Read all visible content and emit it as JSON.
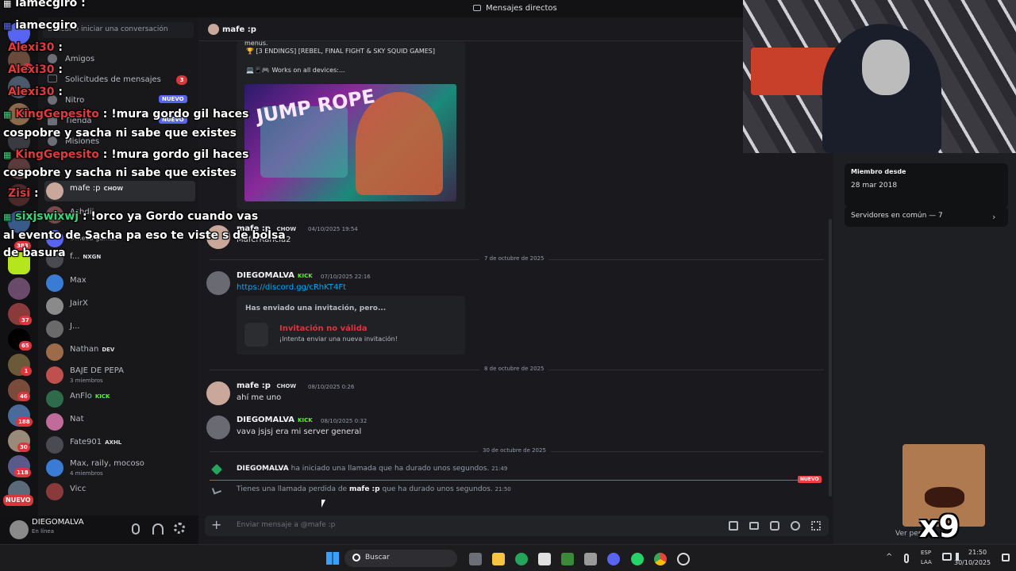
{
  "window": {
    "title": "Mensajes directos"
  },
  "sidebar": {
    "search_placeholder": "Buscar o iniciar una conversación",
    "nav": [
      {
        "label": "Amigos"
      },
      {
        "label": "Solicitudes de mensajes",
        "badge": "3"
      },
      {
        "label": "Nitro",
        "badge": "NUEVO"
      },
      {
        "label": "Tienda",
        "badge": "NUEVO"
      },
      {
        "label": "Misiones"
      }
    ],
    "dms": [
      {
        "name": "mafe :p",
        "tag": "CHOW",
        "color": "#c9a79a"
      },
      {
        "name": "Ashdii",
        "tag": "",
        "color": "#7a4a4a"
      },
      {
        "name": "#meeb-games",
        "tag": "",
        "color": "#5865f2"
      },
      {
        "name": "f...",
        "tag": "NXGN",
        "color": "#4a4a52"
      },
      {
        "name": "Max",
        "tag": "",
        "color": "#3a7bd5"
      },
      {
        "name": "JairX",
        "tag": "",
        "color": "#8a8a8a"
      },
      {
        "name": "J...",
        "tag": "",
        "color": "#6a6a6a"
      },
      {
        "name": "Nathan",
        "tag": "DEV",
        "color": "#9c6b4a"
      },
      {
        "name": "BAJE DE PEPA",
        "sub": "3 miembros",
        "color": "#c0504d"
      },
      {
        "name": "AnFlo",
        "tag": "KICK",
        "color": "#2e6b4a"
      },
      {
        "name": "Nat",
        "tag": "",
        "color": "#c06b9a"
      },
      {
        "name": "Fate901",
        "tag": "AXHL",
        "color": "#4a4a52"
      },
      {
        "name": "Max, raily, mocoso",
        "sub": "4 miembros",
        "color": "#3a7bd5"
      },
      {
        "name": "Vicc",
        "tag": "",
        "color": "#8a3a3a"
      }
    ]
  },
  "server_rail": {
    "badges": [
      "3",
      "383",
      "37",
      "65",
      "1",
      "46",
      "188",
      "30",
      "118"
    ],
    "new_label": "NUEVO"
  },
  "user_panel": {
    "name": "DIEGOMALVA",
    "status": "En línea"
  },
  "chat": {
    "recipient": "mafe :p",
    "embed_line1": "menus.",
    "embed_line2": "[3 ENDINGS] [REBEL, FINAL FIGHT & SKY SQUID GAMES]",
    "embed_line3": "Works on all devices:...",
    "embed_image_text": "JUMP ROPE",
    "messages": [
      {
        "author": "mafe :p",
        "tag": "CHOW",
        "time": "04/10/2025 19:54",
        "text": "MaferRancia2"
      },
      {
        "author": "DIEGOMALVA",
        "tag": "KICK",
        "time": "07/10/2025 22:16",
        "link": "https://discord.gg/cRhKT4Ft"
      },
      {
        "author": "mafe :p",
        "tag": "CHOW",
        "time": "08/10/2025 0:26",
        "text": "ahí me uno"
      },
      {
        "author": "DIEGOMALVA",
        "tag": "KICK",
        "time": "08/10/2025 0:32",
        "text": "vava jsjsj era mi server general"
      }
    ],
    "invite": {
      "heading": "Has enviado una invitación, pero...",
      "title": "Invitación no válida",
      "subtitle": "¡Intenta enviar una nueva invitación!"
    },
    "dividers": [
      "7 de octubre de 2025",
      "8 de octubre de 2025",
      "30 de octubre de 2025"
    ],
    "call1": {
      "author": "DIEGOMALVA",
      "text": "ha iniciado una llamada que ha durado unos segundos.",
      "time": "21:49"
    },
    "call2": {
      "prefix": "Tienes una llamada perdida de",
      "author": "mafe :p",
      "text": "que ha durado unos segundos.",
      "time": "21:50"
    },
    "new_label": "NUEVO",
    "input_placeholder": "Enviar mensaje a @mafe :p"
  },
  "profile": {
    "member_since_label": "Miembro desde",
    "member_since": "28 mar 2018",
    "servers_common": "Servidores en común — 7",
    "view_profile": "Ver perfil"
  },
  "overlay_chat": [
    {
      "user": "iamecgiro",
      "text": ":"
    },
    {
      "user": "iamecgiro",
      "text": ""
    },
    {
      "user": "Alexi30",
      "text": ":"
    },
    {
      "user": "Alexi30",
      "text": ":"
    },
    {
      "user": "Alexi30",
      "text": ":"
    },
    {
      "user": "KingGepesito",
      "text": ": !mura gordo gil haces"
    },
    {
      "user": "",
      "text": "cospobre y sacha ni sabe que existes"
    },
    {
      "user": "KingGepesito",
      "text": ": !mura gordo gil haces"
    },
    {
      "user": "",
      "text": "cospobre y sacha ni sabe que existes"
    },
    {
      "user": "Zisi",
      "text": ":"
    },
    {
      "user": "sixjswixwj",
      "text": ": !orco ya Gordo cuando vas"
    },
    {
      "user": "",
      "text": "al evento de Sacha pa eso te viste s de bolsa"
    },
    {
      "user": "",
      "text": "de basura"
    }
  ],
  "emote_text": "x9",
  "taskbar": {
    "search": "Buscar",
    "lang1": "ESP",
    "lang2": "LAA",
    "time": "21:50",
    "date": "30/10/2025"
  }
}
